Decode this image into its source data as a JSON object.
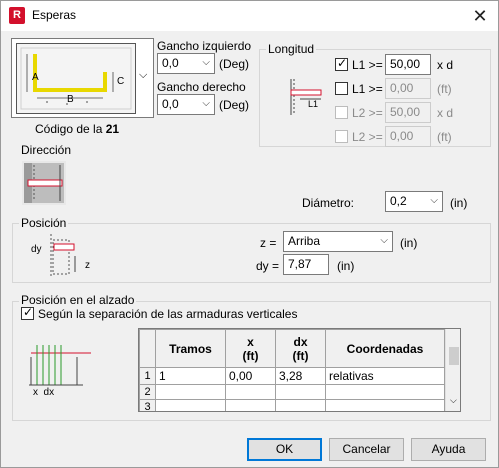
{
  "window": {
    "title": "Esperas",
    "app_icon_letter": "R",
    "close_glyph": "✕"
  },
  "hook": {
    "left_label": "Gancho izquierdo",
    "left_value": "0,0",
    "right_label": "Gancho derecho",
    "right_value": "0,0",
    "unit": "(Deg)",
    "code_prefix": "Código de la",
    "code_number": "21",
    "shape_labels": {
      "a": "A",
      "b": "B",
      "c": "C"
    }
  },
  "longitud": {
    "title": "Longitud",
    "rows": [
      {
        "checked": true,
        "enabled": true,
        "label": "L1 >=",
        "value": "50,00",
        "unit": "x d"
      },
      {
        "checked": false,
        "enabled": true,
        "label": "L1 >=",
        "value": "0,00",
        "unit": "(ft)"
      },
      {
        "checked": false,
        "enabled": false,
        "label": "L2 >=",
        "value": "50,00",
        "unit": "x d"
      },
      {
        "checked": false,
        "enabled": false,
        "label": "L2 >=",
        "value": "0,00",
        "unit": "(ft)"
      }
    ],
    "diagram_label": "L1"
  },
  "direccion": {
    "title": "Dirección"
  },
  "diametro": {
    "label": "Diámetro:",
    "value": "0,2",
    "unit": "(in)"
  },
  "posicion": {
    "title": "Posición",
    "z_label": "z =",
    "z_value": "Arriba",
    "z_unit": "(in)",
    "dy_label": "dy =",
    "dy_value": "7,87",
    "dy_unit": "(in)",
    "diagram_dy": "dy",
    "diagram_z": "z"
  },
  "alzado": {
    "title": "Posición en el alzado",
    "checkbox_label": "Según la separación de las armaduras verticales",
    "checked": true,
    "diagram_label": "x  dx",
    "table": {
      "headers": [
        {
          "line1": "Tramos",
          "line2": ""
        },
        {
          "line1": "x",
          "line2": "(ft)"
        },
        {
          "line1": "dx",
          "line2": "(ft)"
        },
        {
          "line1": "Coordenadas",
          "line2": ""
        }
      ],
      "rows": [
        {
          "num": "1",
          "tramos": "1",
          "x": "0,00",
          "dx": "3,28",
          "coord": "relativas"
        },
        {
          "num": "2",
          "tramos": "",
          "x": "",
          "dx": "",
          "coord": ""
        },
        {
          "num": "3",
          "tramos": "",
          "x": "",
          "dx": "",
          "coord": ""
        }
      ]
    }
  },
  "buttons": {
    "ok": "OK",
    "cancel": "Cancelar",
    "help": "Ayuda"
  },
  "colors": {
    "accent": "#0078d7",
    "rebar": "#e8d800",
    "red": "#d3102c"
  }
}
